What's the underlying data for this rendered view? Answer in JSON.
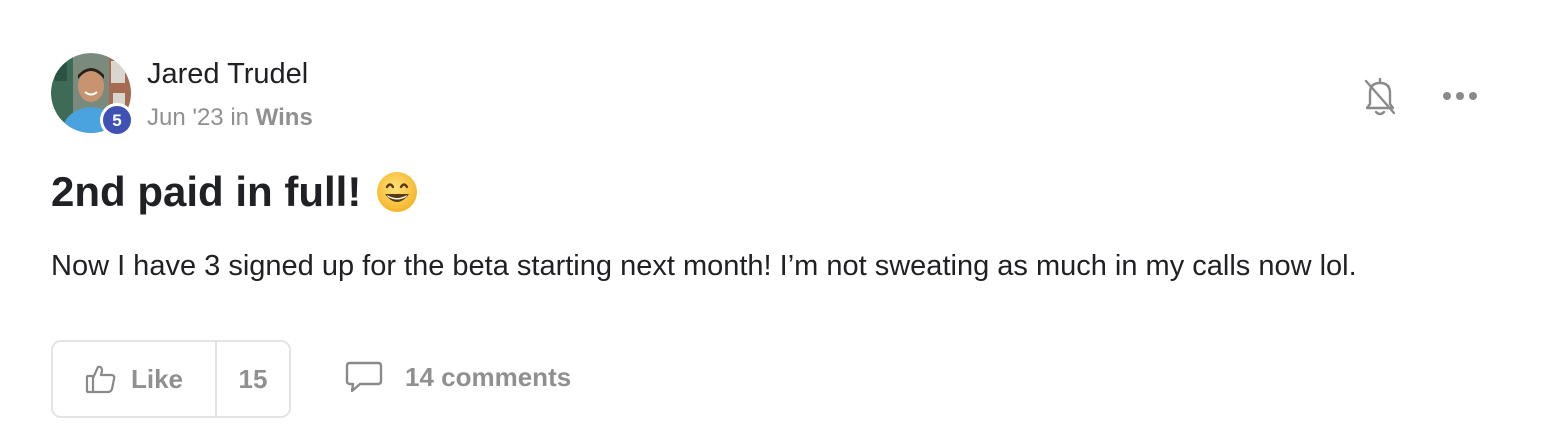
{
  "post": {
    "author": {
      "name": "Jared Trudel",
      "level": "5"
    },
    "meta": {
      "date": "Jun '23",
      "in_word": "in",
      "category": "Wins"
    },
    "title": "2nd paid in full!",
    "title_emoji": "grinning-face-emoji",
    "body": "Now I have 3 signed up for the beta starting next month! I’m not sweating as much in my calls now lol.",
    "actions": {
      "like_label": "Like",
      "like_count": "15",
      "comments_label": "14 comments"
    },
    "icons": {
      "notifications": "bell-off-icon",
      "more": "more-horizontal-icon",
      "like": "thumbs-up-icon",
      "comments": "speech-bubble-icon"
    }
  },
  "colors": {
    "level_badge": "#3f51b5",
    "text_primary": "#202124",
    "text_muted": "#909090",
    "border": "#e4e4e4"
  }
}
